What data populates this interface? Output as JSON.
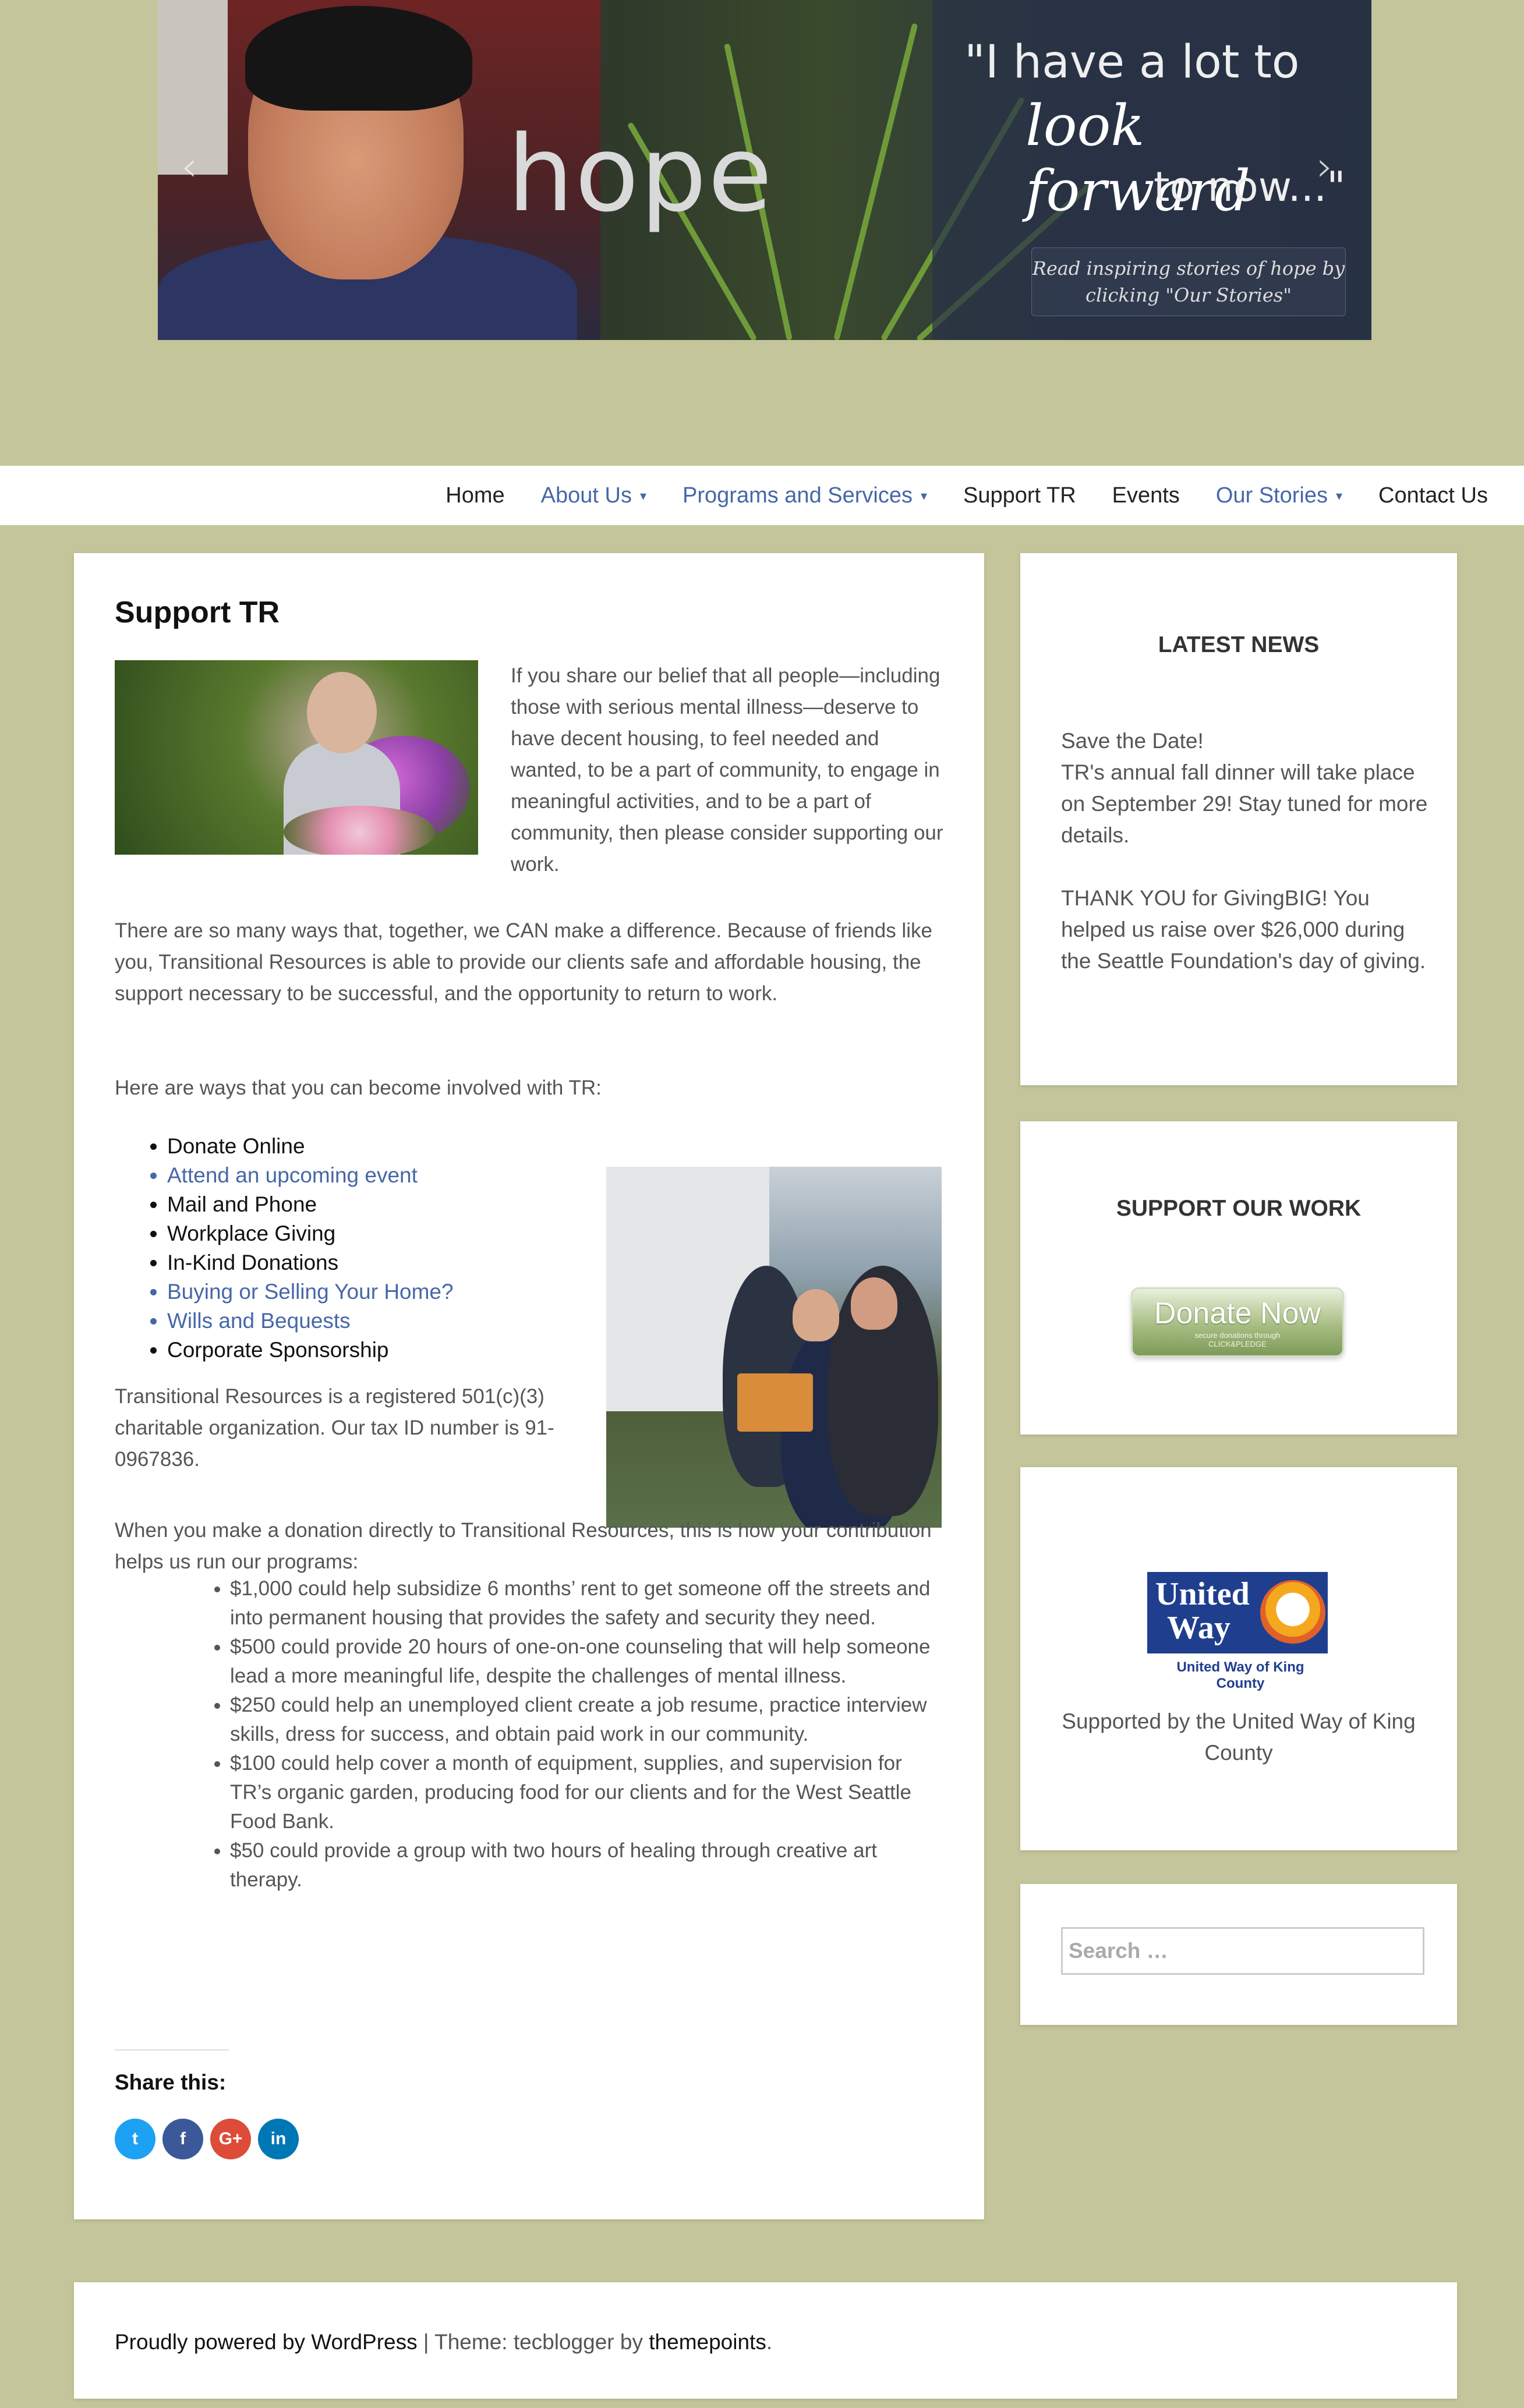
{
  "hero": {
    "word": "hope",
    "quote_line1": "\"I have a lot to",
    "quote_line2": "look forward",
    "quote_line3": "to now...\"",
    "caption_line1": "Read inspiring stories of hope by",
    "caption_line2": "clicking \"Our Stories\"",
    "prev_arrow": "‹",
    "next_arrow": "›"
  },
  "nav": {
    "items": [
      {
        "label": "Home",
        "dropdown": false
      },
      {
        "label": "About Us",
        "dropdown": true
      },
      {
        "label": "Programs and Services",
        "dropdown": true
      },
      {
        "label": "Support TR",
        "dropdown": false
      },
      {
        "label": "Events",
        "dropdown": false
      },
      {
        "label": "Our Stories",
        "dropdown": true
      },
      {
        "label": "Contact Us",
        "dropdown": false
      }
    ],
    "caret": "▾"
  },
  "main": {
    "title": "Support TR",
    "intro": "If you share our belief that all people—including those with serious mental illness—deserve to have decent housing, to feel needed and wanted, to be a part of community, to engage in meaningful activities, and to be a part of community, then please consider supporting our work.",
    "para2": "There are so many ways that, together, we CAN make a difference. Because of friends like you, Transitional Resources is able to provide our clients safe and affordable housing, the support necessary to be successful, and the opportunity to return to work.",
    "para3": "Here are ways that you can become involved with TR:",
    "ways": [
      "Donate Online",
      "Attend an upcoming event",
      "Mail and Phone",
      "Workplace Giving",
      "In-Kind Donations",
      "Buying or Selling Your Home?",
      "Wills and Bequests",
      "Corporate Sponsorship"
    ],
    "para4": "Transitional Resources is a registered 501(c)(3) charitable organization. Our tax ID number is 91-0967836.",
    "para5": "When you make a donation directly to Transitional Resources, this is how your contribution helps us run our programs:",
    "amounts": [
      "$1,000 could help subsidize 6 months’ rent to get someone off the streets and into permanent housing that provides the safety and security they need.",
      "$500 could provide 20 hours of one-on-one counseling that will help someone lead a more meaningful life, despite the challenges of mental illness.",
      "$250 could help an unemployed client create a job resume, practice interview skills, dress for success, and obtain paid work in our community.",
      "$100 could help cover a month of equipment, supplies, and supervision for TR’s organic garden, producing food for our clients and for the West Seattle Food Bank.",
      "$50 could provide a group with two hours of healing through creative art therapy."
    ],
    "share_label": "Share this:",
    "share": [
      {
        "icon": "twitter-icon",
        "glyph": "t",
        "color": "#1da1f2"
      },
      {
        "icon": "facebook-icon",
        "glyph": "f",
        "color": "#3b5998"
      },
      {
        "icon": "google-plus-icon",
        "glyph": "G+",
        "color": "#dd4b39"
      },
      {
        "icon": "linkedin-icon",
        "glyph": "in",
        "color": "#0077b5"
      }
    ]
  },
  "sidebar": {
    "news_heading": "LATEST NEWS",
    "news_line1": "Save the Date!",
    "news_line2": "TR's annual fall dinner will take place on September 29! Stay tuned for more details.",
    "news_line3": "THANK YOU for GivingBIG! You helped us raise over $26,000 during the Seattle Foundation's day of giving.",
    "support_heading": "SUPPORT OUR WORK",
    "donate_label": "Donate Now",
    "donate_sub1": "secure donations through",
    "donate_sub2": "CLICK&PLEDGE",
    "uw_logo_line1": "United",
    "uw_logo_line2": "Way",
    "uw_logo_caption": "United Way of King County",
    "uw_text": "Supported by the United Way of King County",
    "search_placeholder": "Search …"
  },
  "footer": {
    "powered": "Proudly powered by WordPress",
    "separator": " | Theme: tecblogger by ",
    "theme_author": "themepoints",
    "period": "."
  },
  "colors": {
    "background": "#c4c59a",
    "link": "#4667a8",
    "heading": "#111111"
  }
}
